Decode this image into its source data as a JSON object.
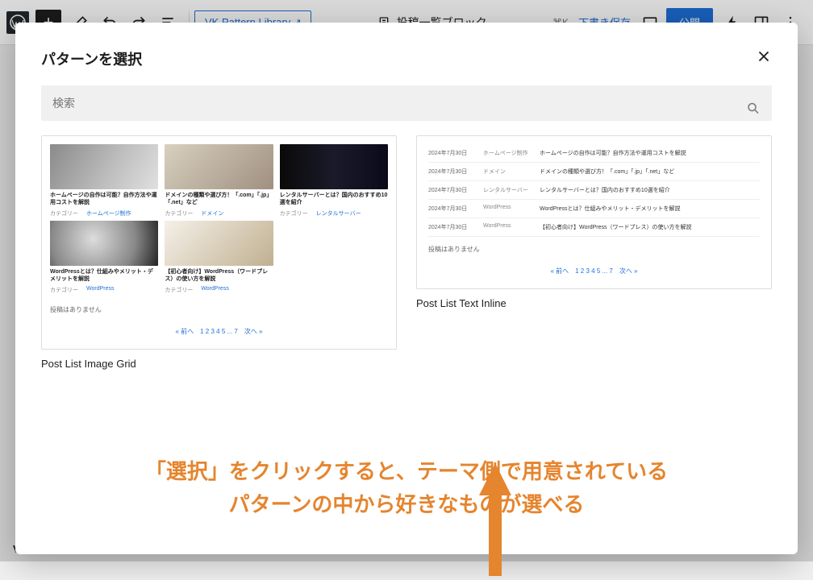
{
  "toolbar": {
    "vk_link_label": "VK Pattern Library",
    "doc_title": "投稿一覧ブロック",
    "keyboard_shortcut": "⌘K",
    "draft_save": "下書き保存",
    "publish": "公開"
  },
  "modal": {
    "title": "パターンを選択",
    "search_placeholder": "検索"
  },
  "pattern_a": {
    "label": "Post List Image Grid",
    "cards_row1": [
      {
        "title": "ホームページの自作は可能？自作方法や運用コストを解説",
        "cat_label": "カテゴリー",
        "cat": "ホームページ制作"
      },
      {
        "title": "ドメインの種類や選び方！「.com」「.jp」「.net」など",
        "cat_label": "カテゴリー",
        "cat": "ドメイン"
      },
      {
        "title": "レンタルサーバーとは？国内のおすすめ10選を紹介",
        "cat_label": "カテゴリー",
        "cat": "レンタルサーバー"
      }
    ],
    "cards_row2": [
      {
        "title": "WordPressとは？仕組みやメリット・デメリットを解説",
        "cat_label": "カテゴリー",
        "cat": "WordPress"
      },
      {
        "title": "【初心者向け】WordPress（ワードプレス）の使い方を解説",
        "cat_label": "カテゴリー",
        "cat": "WordPress"
      }
    ],
    "no_posts": "投稿はありません",
    "pagination": "« 前へ　1 2 3 4 5 ... 7　次へ »"
  },
  "pattern_b": {
    "label": "Post List Text Inline",
    "rows": [
      {
        "date": "2024年7月30日",
        "cat": "ホームページ制作",
        "title": "ホームページの自作は可能？自作方法や運用コストを解説"
      },
      {
        "date": "2024年7月30日",
        "cat": "ドメイン",
        "title": "ドメインの種類や選び方！「.com」「.jp」「.net」など"
      },
      {
        "date": "2024年7月30日",
        "cat": "レンタルサーバー",
        "title": "レンタルサーバーとは？国内のおすすめ10選を紹介"
      },
      {
        "date": "2024年7月30日",
        "cat": "WordPress",
        "title": "WordPressとは？仕組みやメリット・デメリットを解説"
      },
      {
        "date": "2024年7月30日",
        "cat": "WordPress",
        "title": "【初心者向け】WordPress（ワードプレス）の使い方を解説"
      }
    ],
    "no_posts": "投稿はありません",
    "pagination": "« 前へ　1 2 3 4 5 ... 7　次へ »"
  },
  "annotation": {
    "line1": "「選択」をクリックすると、テーマ側で用意されている",
    "line2": "パターンの中から好きなものが選べる"
  },
  "footer": {
    "vk": "VK"
  },
  "colors": {
    "accent": "#1e6fd9",
    "annotation": "#e5852e"
  }
}
